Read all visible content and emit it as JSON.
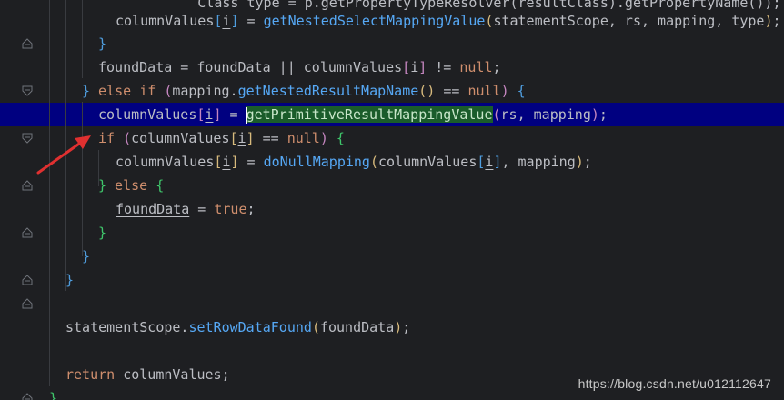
{
  "editor": {
    "lines": [
      {
        "current": false,
        "tokens": [
          {
            "t": "id",
            "v": "          Class type = p.getPropertyTypeResolver(resultClass).getPropertyName());"
          }
        ]
      },
      {
        "current": false,
        "tokens": [
          {
            "t": "id",
            "v": "columnValues"
          },
          {
            "t": "br3",
            "v": "["
          },
          {
            "t": "var",
            "v": "i"
          },
          {
            "t": "br3",
            "v": "]"
          },
          {
            "t": "pun",
            "v": " = "
          },
          {
            "t": "fn",
            "v": "getNestedSelectMappingValue"
          },
          {
            "t": "br1",
            "v": "("
          },
          {
            "t": "id",
            "v": "statementScope, rs, mapping, type"
          },
          {
            "t": "br1",
            "v": ")"
          },
          {
            "t": "pun",
            "v": ";"
          }
        ]
      },
      {
        "current": false,
        "tokens": [
          {
            "t": "br3",
            "v": "}"
          }
        ]
      },
      {
        "current": false,
        "tokens": [
          {
            "t": "var",
            "v": "foundData"
          },
          {
            "t": "pun",
            "v": " = "
          },
          {
            "t": "var",
            "v": "foundData"
          },
          {
            "t": "pun",
            "v": " || "
          },
          {
            "t": "id",
            "v": "columnValues"
          },
          {
            "t": "br2",
            "v": "["
          },
          {
            "t": "var",
            "v": "i"
          },
          {
            "t": "br2",
            "v": "]"
          },
          {
            "t": "pun",
            "v": " != "
          },
          {
            "t": "kw",
            "v": "null"
          },
          {
            "t": "pun",
            "v": ";"
          }
        ]
      },
      {
        "current": false,
        "tokens": [
          {
            "t": "br3",
            "v": "}"
          },
          {
            "t": "kw",
            "v": " else if "
          },
          {
            "t": "br2",
            "v": "("
          },
          {
            "t": "id",
            "v": "mapping."
          },
          {
            "t": "fn",
            "v": "getNestedResultMapName"
          },
          {
            "t": "br1",
            "v": "()"
          },
          {
            "t": "pun",
            "v": " == "
          },
          {
            "t": "kw",
            "v": "null"
          },
          {
            "t": "br2",
            "v": ")"
          },
          {
            "t": "pun",
            "v": " "
          },
          {
            "t": "br3",
            "v": "{"
          }
        ]
      },
      {
        "current": true,
        "tokens": [
          {
            "t": "id",
            "v": "columnValues"
          },
          {
            "t": "br2",
            "v": "["
          },
          {
            "t": "var",
            "v": "i"
          },
          {
            "t": "br2",
            "v": "]"
          },
          {
            "t": "pun",
            "v": " = "
          },
          {
            "t": "caret",
            "v": ""
          },
          {
            "t": "sel",
            "v": "getPrimitiveResultMappingValue"
          },
          {
            "t": "br2",
            "v": "("
          },
          {
            "t": "id",
            "v": "rs, mapping"
          },
          {
            "t": "br2",
            "v": ")"
          },
          {
            "t": "pun",
            "v": ";"
          }
        ]
      },
      {
        "current": false,
        "tokens": [
          {
            "t": "kw",
            "v": "if "
          },
          {
            "t": "br2",
            "v": "("
          },
          {
            "t": "id",
            "v": "columnValues"
          },
          {
            "t": "br1",
            "v": "["
          },
          {
            "t": "var",
            "v": "i"
          },
          {
            "t": "br1",
            "v": "]"
          },
          {
            "t": "pun",
            "v": " == "
          },
          {
            "t": "kw",
            "v": "null"
          },
          {
            "t": "br2",
            "v": ")"
          },
          {
            "t": "pun",
            "v": " "
          },
          {
            "t": "br4",
            "v": "{"
          }
        ]
      },
      {
        "current": false,
        "tokens": [
          {
            "t": "id",
            "v": "columnValues"
          },
          {
            "t": "br1",
            "v": "["
          },
          {
            "t": "var",
            "v": "i"
          },
          {
            "t": "br1",
            "v": "]"
          },
          {
            "t": "pun",
            "v": " = "
          },
          {
            "t": "fn",
            "v": "doNullMapping"
          },
          {
            "t": "br1",
            "v": "("
          },
          {
            "t": "id",
            "v": "columnValues"
          },
          {
            "t": "br3",
            "v": "["
          },
          {
            "t": "var",
            "v": "i"
          },
          {
            "t": "br3",
            "v": "]"
          },
          {
            "t": "id",
            "v": ", mapping"
          },
          {
            "t": "br1",
            "v": ")"
          },
          {
            "t": "pun",
            "v": ";"
          }
        ]
      },
      {
        "current": false,
        "tokens": [
          {
            "t": "br4",
            "v": "}"
          },
          {
            "t": "kw",
            "v": " else "
          },
          {
            "t": "br4",
            "v": "{"
          }
        ]
      },
      {
        "current": false,
        "tokens": [
          {
            "t": "var",
            "v": "foundData"
          },
          {
            "t": "pun",
            "v": " = "
          },
          {
            "t": "kw",
            "v": "true"
          },
          {
            "t": "pun",
            "v": ";"
          }
        ]
      },
      {
        "current": false,
        "tokens": [
          {
            "t": "br4",
            "v": "}"
          }
        ]
      },
      {
        "current": false,
        "tokens": [
          {
            "t": "br3",
            "v": "}"
          }
        ]
      },
      {
        "current": false,
        "tokens": [
          {
            "t": "br3",
            "v": "}"
          }
        ]
      },
      {
        "current": false,
        "tokens": []
      },
      {
        "current": false,
        "tokens": [
          {
            "t": "id",
            "v": "statementScope."
          },
          {
            "t": "fn",
            "v": "setRowDataFound"
          },
          {
            "t": "br1",
            "v": "("
          },
          {
            "t": "var",
            "v": "foundData"
          },
          {
            "t": "br1",
            "v": ")"
          },
          {
            "t": "pun",
            "v": ";"
          }
        ]
      },
      {
        "current": false,
        "tokens": []
      },
      {
        "current": false,
        "tokens": [
          {
            "t": "kw",
            "v": "return "
          },
          {
            "t": "id",
            "v": "columnValues"
          },
          {
            "t": "pun",
            "v": ";"
          }
        ]
      },
      {
        "current": false,
        "tokens": [
          {
            "t": "br4",
            "v": "}"
          }
        ]
      }
    ]
  },
  "watermark": "https://blog.csdn.net/u012112647",
  "colors": {
    "background": "#1e1f22",
    "current_line": "#000080",
    "selection": "#1a5c2a",
    "keyword": "#cf8e6d",
    "method": "#56a8f5",
    "annotation_arrow": "#e03030"
  }
}
